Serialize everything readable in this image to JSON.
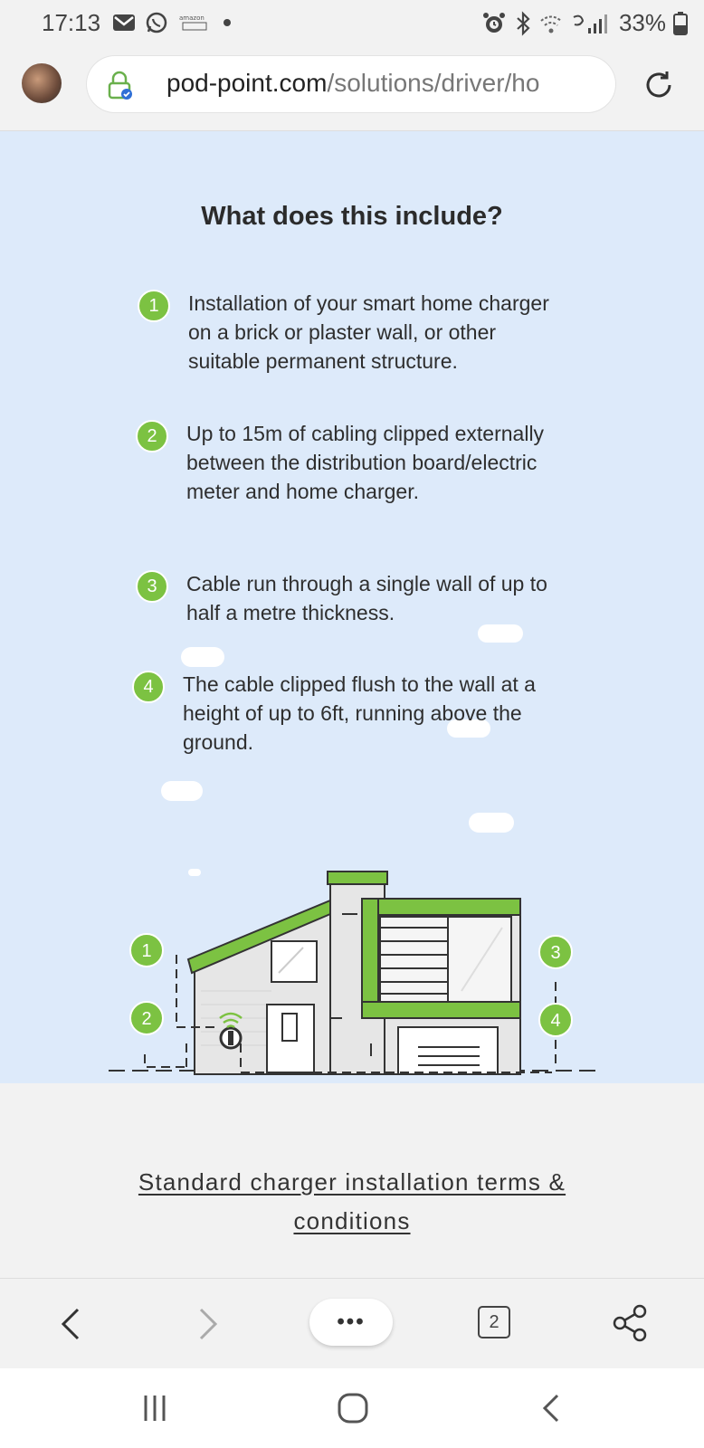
{
  "status_bar": {
    "time": "17:13",
    "battery": "33%",
    "icons_left": [
      "mail-icon",
      "whatsapp-icon",
      "amazon-icon",
      "dot-icon"
    ],
    "icons_right": [
      "alarm-icon",
      "bluetooth-icon",
      "wifi-icon",
      "signal-icon",
      "battery-icon"
    ]
  },
  "browser": {
    "url_host": "pod-point.com",
    "url_path": "/solutions/driver/ho",
    "tab_count": "2",
    "menu_label": "•••"
  },
  "page": {
    "heading": "What does this include?",
    "items": [
      {
        "number": "1",
        "text": "Installation of your smart home charger on a brick or plaster wall, or other suitable permanent structure."
      },
      {
        "number": "2",
        "text": "Up to 15m of cabling clipped externally between the distribution board/electric meter and home charger."
      },
      {
        "number": "3",
        "text": "Cable run through a single wall of up to half a metre thickness."
      },
      {
        "number": "4",
        "text": "The cable clipped flush to the wall at a height of up to 6ft, running above the ground."
      }
    ],
    "illustration_markers": [
      "1",
      "2",
      "3",
      "4"
    ],
    "terms_link_line1": "Standard charger installation terms &",
    "terms_link_line2": "conditions"
  },
  "colors": {
    "accent_green": "#7cc242",
    "hero_bg": "#ddeafa"
  }
}
